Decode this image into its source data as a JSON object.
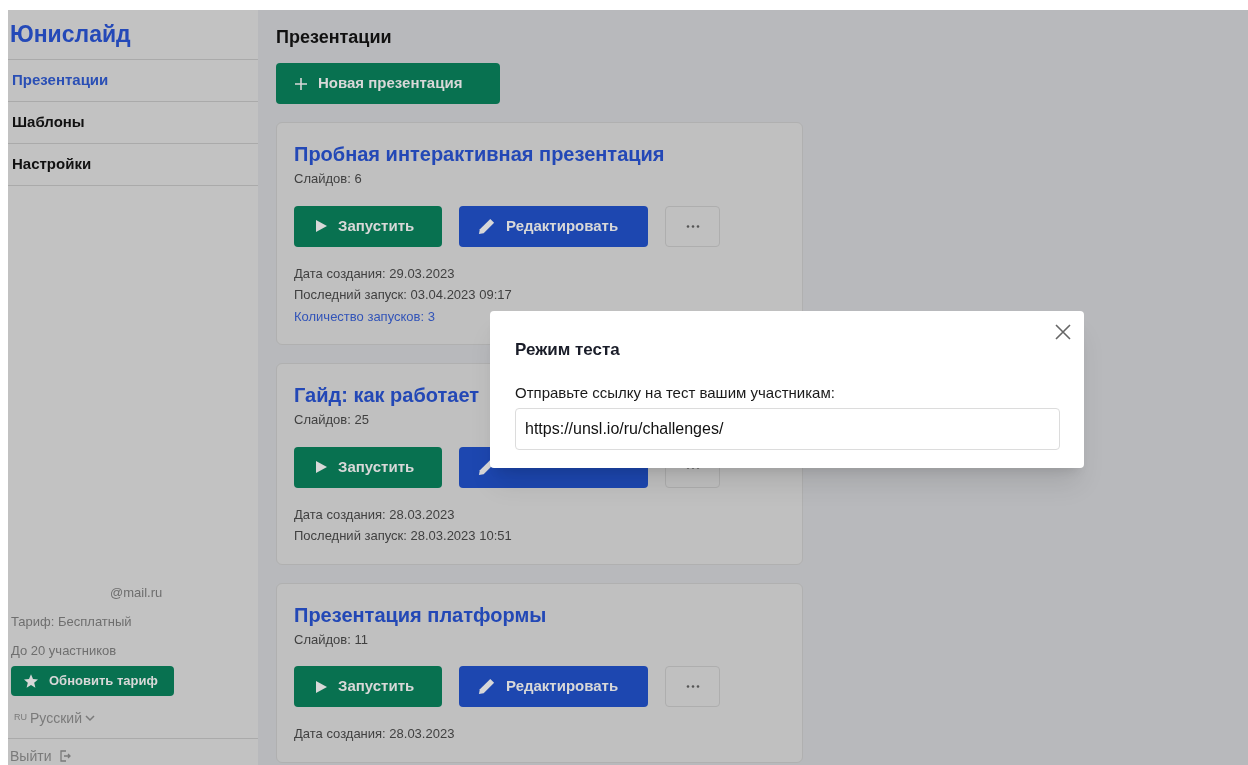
{
  "sidebar": {
    "logo": "Юнислайд",
    "nav": [
      {
        "label": "Презентации",
        "selected": true
      },
      {
        "label": "Шаблоны",
        "selected": false
      },
      {
        "label": "Настройки",
        "selected": false
      }
    ],
    "account": {
      "email": "@mail.ru",
      "plan": "Тариф: Бесплатный",
      "limit": "До 20 участников",
      "upgrade_button": "Обновить тариф",
      "language_code": "RU",
      "language": "Русский",
      "logout": "Выйти"
    }
  },
  "main": {
    "title": "Презентации",
    "new_button": "Новая презентация",
    "cards": [
      {
        "title": "Пробная интерактивная презентация",
        "slides": "Слайдов: 6",
        "run_button": "Запустить",
        "edit_button": "Редактировать",
        "details": [
          {
            "text": "Дата создания: 29.03.2023",
            "kind": "plain"
          },
          {
            "text": "Последний запуск: 03.04.2023 09:17",
            "kind": "plain"
          },
          {
            "text": "Количество запусков: 3",
            "kind": "link"
          }
        ]
      },
      {
        "title": "Гайд: как работает",
        "slides": "Слайдов: 25",
        "run_button": "Запустить",
        "details": [
          {
            "text": "Дата создания: 28.03.2023",
            "kind": "plain"
          },
          {
            "text": "Последний запуск: 28.03.2023 10:51",
            "kind": "plain"
          }
        ]
      },
      {
        "title": "Презентация платформы",
        "slides": "Слайдов: 11",
        "run_button": "Запустить",
        "edit_button": "Редактировать",
        "details": [
          {
            "text": "Дата создания: 28.03.2023",
            "kind": "plain"
          }
        ]
      }
    ]
  },
  "modal": {
    "title": "Режим теста",
    "label": "Отправьте ссылку на тест вашим участникам:",
    "link_field": {
      "value": "https://unsl.io/ru/challenges/"
    }
  }
}
